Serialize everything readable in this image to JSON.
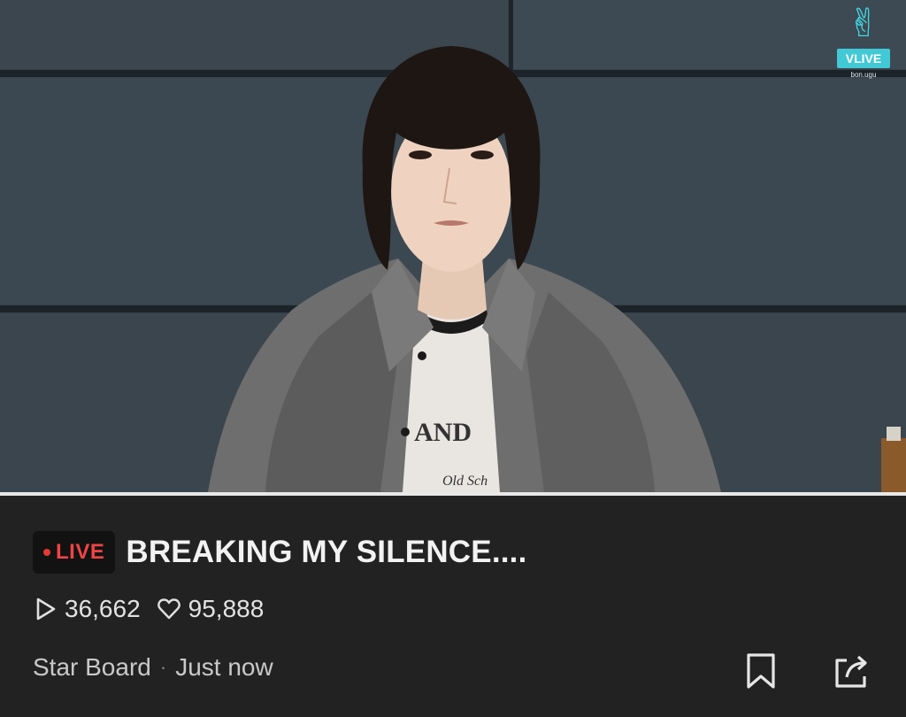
{
  "video": {
    "watermark": {
      "logo_icon": "v-hand-icon",
      "brand_label": "VLIVE",
      "channel_tag": "bon.ugu"
    }
  },
  "stream": {
    "live_label": "LIVE",
    "title": "BREAKING MY SILENCE....",
    "views": "36,662",
    "likes": "95,888",
    "board": "Star Board",
    "separator": "·",
    "time": "Just now"
  },
  "actions": {
    "bookmark_icon": "bookmark-icon",
    "share_icon": "share-icon"
  },
  "colors": {
    "background": "#222222",
    "live_red": "#ef4444",
    "vlive_cyan": "#41c9d6"
  }
}
